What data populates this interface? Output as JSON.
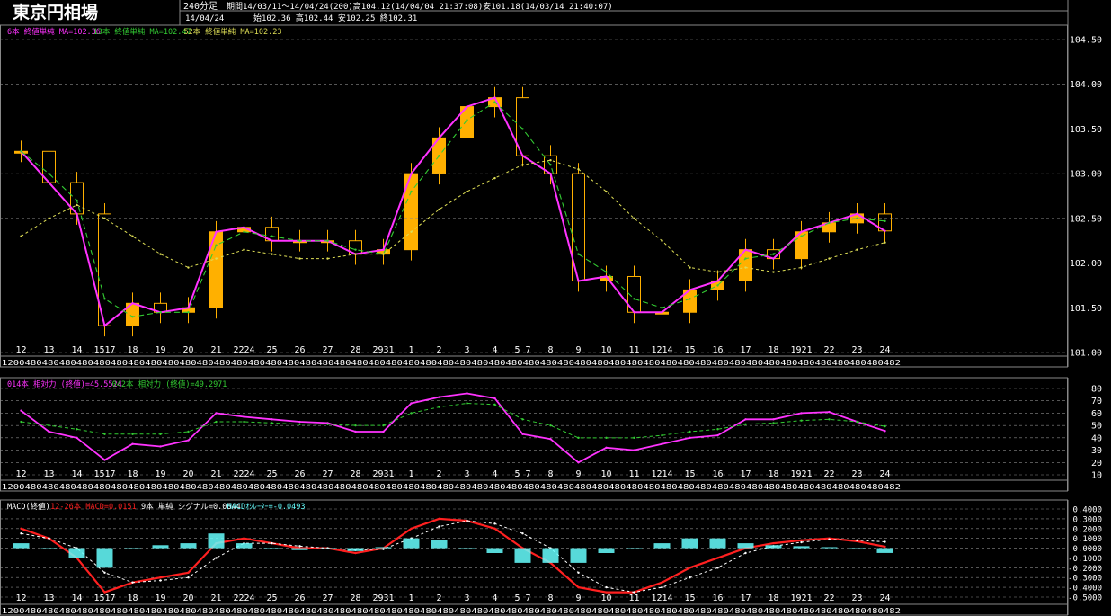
{
  "header": {
    "symbol": "東京円相場",
    "period_label": "240分足",
    "range_info": "期間14/03/11〜14/04/24(200)高104.12(14/04/04 21:37:08)安101.18(14/03/14 21:40:07)",
    "date": "14/04/24",
    "ohlc_info": "始102.36 高102.44 安102.25 終102.31"
  },
  "colors": {
    "background": "#000000",
    "grid": "#8a8a8a",
    "up_candle": "#ffb000",
    "ma_short": "#ff33ff",
    "ma_mid": "#33cc33",
    "ma_long": "#dddd55",
    "macd_line": "#ff2020",
    "signal_line": "#ffffff",
    "histogram": "#66ffff"
  },
  "x_axis": {
    "day_labels": [
      "12",
      "13",
      "14",
      "1517",
      "18",
      "19",
      "20",
      "21",
      "2224",
      "25",
      "26",
      "27",
      "28",
      "2931",
      "1",
      "2",
      "3",
      "4",
      "5 7",
      "8",
      "9",
      "10",
      "11",
      "1214",
      "15",
      "16",
      "17",
      "18",
      "1921",
      "22",
      "23",
      "24"
    ],
    "hour_strip": "1200480480480480480480480480480480480480480480480480480480480480480480480480480480480480480480480480480480480480480480480480480480480480480480480480480480482"
  },
  "price_panel": {
    "legend": [
      {
        "text": "6本 終値単純 MA=102.36",
        "color": "#ff33ff"
      },
      {
        "text": "13本 終値単純 MA=102.47",
        "color": "#33cc33"
      },
      {
        "text": "52本 終値単純 MA=102.23",
        "color": "#dddd55"
      }
    ],
    "y_ticks": [
      "104.50",
      "104.00",
      "103.50",
      "103.00",
      "102.50",
      "102.00",
      "101.50",
      "101.00"
    ]
  },
  "rsi_panel": {
    "legend": [
      {
        "text": "014本 相対力 (終値)=45.5524",
        "color": "#ff33ff"
      },
      {
        "text": "042本 相対力 (終値)=49.2971",
        "color": "#33cc33"
      }
    ],
    "y_ticks": [
      "80",
      "70",
      "60",
      "50",
      "40",
      "30",
      "20",
      "10"
    ]
  },
  "macd_panel": {
    "legend": [
      {
        "text": "MACD(終値)",
        "color": "#ffffff"
      },
      {
        "text": "12-26本 MACD=0.0151",
        "color": "#ff2020"
      },
      {
        "text": "9本 単純 シグナル=0.0644",
        "color": "#ffffff"
      },
      {
        "text": "MACDｵｼﾚｰﾀｰ=-0.0493",
        "color": "#66ffff"
      }
    ],
    "y_ticks": [
      "0.4000",
      "0.3000",
      "0.2000",
      "0.1000",
      "0.0000",
      "-0.1000",
      "-0.2000",
      "-0.3000",
      "-0.4000",
      "-0.5000"
    ]
  },
  "chart_data": [
    {
      "type": "line",
      "title": "東京円相場 240分足",
      "x": [
        "12",
        "13",
        "14",
        "1517",
        "18",
        "19",
        "20",
        "21",
        "2224",
        "25",
        "26",
        "27",
        "28",
        "2931",
        "1",
        "2",
        "3",
        "4",
        "5 7",
        "8",
        "9",
        "10",
        "11",
        "1214",
        "15",
        "16",
        "17",
        "18",
        "1921",
        "22",
        "23",
        "24"
      ],
      "ylim": [
        101.0,
        104.5
      ],
      "series": [
        {
          "name": "6本 終値単純 MA",
          "values": [
            103.25,
            102.9,
            102.55,
            101.3,
            101.55,
            101.45,
            101.5,
            102.35,
            102.4,
            102.25,
            102.25,
            102.25,
            102.1,
            102.15,
            103.0,
            103.4,
            103.75,
            103.85,
            103.2,
            103.0,
            101.8,
            101.85,
            101.45,
            101.45,
            101.7,
            101.8,
            102.15,
            102.05,
            102.35,
            102.45,
            102.55,
            102.36
          ]
        },
        {
          "name": "13本 終値単純 MA",
          "values": [
            103.25,
            103.0,
            102.7,
            101.6,
            101.4,
            101.45,
            101.45,
            102.2,
            102.35,
            102.3,
            102.25,
            102.25,
            102.15,
            102.1,
            102.8,
            103.2,
            103.6,
            103.8,
            103.5,
            103.1,
            102.1,
            101.9,
            101.6,
            101.5,
            101.6,
            101.75,
            102.05,
            102.1,
            102.3,
            102.45,
            102.5,
            102.47
          ]
        },
        {
          "name": "52本 終値単純 MA",
          "values": [
            102.3,
            102.5,
            102.65,
            102.5,
            102.3,
            102.1,
            101.95,
            102.05,
            102.15,
            102.1,
            102.05,
            102.05,
            102.1,
            102.1,
            102.35,
            102.6,
            102.8,
            102.95,
            103.1,
            103.15,
            103.05,
            102.8,
            102.5,
            102.25,
            101.95,
            101.9,
            101.95,
            101.9,
            101.95,
            102.05,
            102.15,
            102.23
          ]
        }
      ]
    },
    {
      "type": "line",
      "title": "相対力 (終値)",
      "x": [
        "12",
        "13",
        "14",
        "1517",
        "18",
        "19",
        "20",
        "21",
        "2224",
        "25",
        "26",
        "27",
        "28",
        "2931",
        "1",
        "2",
        "3",
        "4",
        "5 7",
        "8",
        "9",
        "10",
        "11",
        "1214",
        "15",
        "16",
        "17",
        "18",
        "1921",
        "22",
        "23",
        "24"
      ],
      "ylim": [
        10,
        80
      ],
      "series": [
        {
          "name": "014本",
          "values": [
            62,
            45,
            40,
            22,
            35,
            33,
            38,
            60,
            57,
            55,
            53,
            52,
            45,
            45,
            68,
            73,
            76,
            72,
            43,
            39,
            20,
            32,
            30,
            35,
            40,
            42,
            55,
            55,
            60,
            61,
            53,
            45.5524
          ]
        },
        {
          "name": "042本",
          "values": [
            53,
            50,
            47,
            43,
            43,
            43,
            45,
            53,
            53,
            52,
            51,
            51,
            50,
            50,
            60,
            65,
            68,
            67,
            55,
            50,
            40,
            40,
            40,
            42,
            45,
            47,
            51,
            52,
            54,
            55,
            53,
            49.2971
          ]
        }
      ]
    },
    {
      "type": "line",
      "title": "MACD(終値)",
      "x": [
        "12",
        "13",
        "14",
        "1517",
        "18",
        "19",
        "20",
        "21",
        "2224",
        "25",
        "26",
        "27",
        "28",
        "2931",
        "1",
        "2",
        "3",
        "4",
        "5 7",
        "8",
        "9",
        "10",
        "11",
        "1214",
        "15",
        "16",
        "17",
        "18",
        "1921",
        "22",
        "23",
        "24"
      ],
      "ylim": [
        -0.5,
        0.4
      ],
      "series": [
        {
          "name": "12-26本 MACD",
          "values": [
            0.2,
            0.1,
            -0.1,
            -0.45,
            -0.35,
            -0.3,
            -0.25,
            0.05,
            0.1,
            0.05,
            0.0,
            0.0,
            -0.05,
            0.0,
            0.2,
            0.3,
            0.28,
            0.2,
            0.0,
            -0.15,
            -0.4,
            -0.45,
            -0.45,
            -0.35,
            -0.2,
            -0.1,
            0.0,
            0.05,
            0.08,
            0.1,
            0.07,
            0.0151
          ]
        },
        {
          "name": "9本 単純 シグナル",
          "values": [
            0.15,
            0.1,
            0.0,
            -0.25,
            -0.35,
            -0.33,
            -0.3,
            -0.1,
            0.05,
            0.05,
            0.02,
            0.0,
            -0.02,
            -0.01,
            0.1,
            0.22,
            0.28,
            0.25,
            0.15,
            0.0,
            -0.25,
            -0.4,
            -0.45,
            -0.4,
            -0.3,
            -0.2,
            -0.05,
            0.02,
            0.06,
            0.09,
            0.08,
            0.0644
          ]
        },
        {
          "name": "MACDｵｼﾚｰﾀｰ",
          "values": [
            0.05,
            0.0,
            -0.1,
            -0.2,
            0.0,
            0.03,
            0.05,
            0.15,
            0.05,
            0.0,
            -0.02,
            0.0,
            -0.03,
            0.01,
            0.1,
            0.08,
            0.0,
            -0.05,
            -0.15,
            -0.15,
            -0.15,
            -0.05,
            0.0,
            0.05,
            0.1,
            0.1,
            0.05,
            0.03,
            0.02,
            0.01,
            -0.01,
            -0.0493
          ]
        }
      ]
    }
  ]
}
